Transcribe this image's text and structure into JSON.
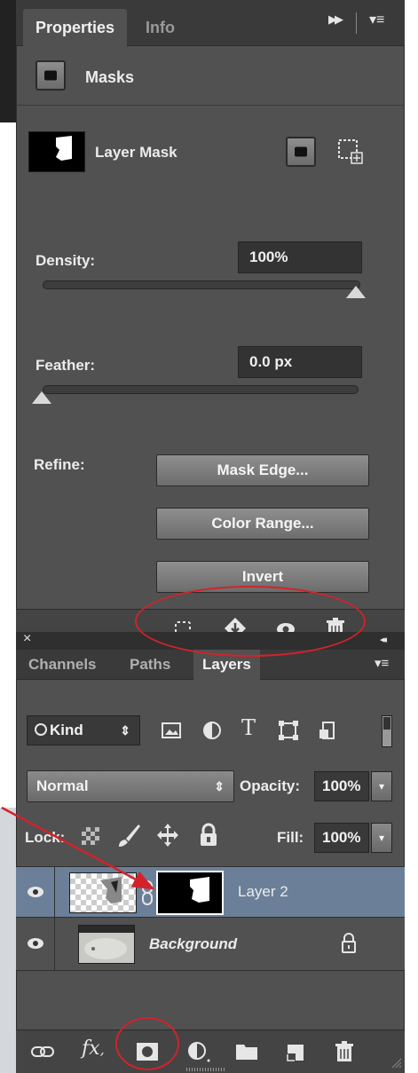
{
  "properties_panel": {
    "tabs": [
      "Properties",
      "Info"
    ],
    "header_icons": [
      "fast-forward-icon",
      "panel-menu-icon"
    ],
    "section_title": "Masks",
    "mask_label": "Layer Mask",
    "density": {
      "label": "Density:",
      "value": "100%",
      "slider_fraction": 1.0
    },
    "feather": {
      "label": "Feather:",
      "value": "0.0 px",
      "slider_fraction": 0.0
    },
    "refine_label": "Refine:",
    "buttons": [
      "Mask Edge...",
      "Color Range...",
      "Invert"
    ],
    "footer_icons": [
      "load-selection-icon",
      "apply-mask-icon",
      "visibility-icon",
      "delete-icon"
    ]
  },
  "layers_panel": {
    "tabs": [
      "Channels",
      "Paths",
      "Layers"
    ],
    "active_tab": "Layers",
    "filter": {
      "label": "Kind",
      "icons": [
        "image-filter-icon",
        "adjustment-filter-icon",
        "type-filter-icon",
        "shape-filter-icon",
        "smart-object-filter-icon"
      ]
    },
    "blend_mode": "Normal",
    "opacity": {
      "label": "Opacity:",
      "value": "100%"
    },
    "lock": {
      "label": "Lock:",
      "icons": [
        "lock-transparent-icon",
        "lock-brush-icon",
        "lock-position-icon",
        "lock-all-icon"
      ]
    },
    "fill": {
      "label": "Fill:",
      "value": "100%"
    },
    "layers": [
      {
        "name": "Layer 2",
        "selected": true,
        "has_mask": true
      },
      {
        "name": "Background",
        "selected": false,
        "locked": true
      }
    ],
    "footer_icons": [
      "link-icon",
      "fx-icon",
      "add-mask-icon",
      "adjustment-icon",
      "folder-icon",
      "new-layer-icon",
      "delete-icon"
    ]
  },
  "symbols": {
    "fast_forward": "▶▶",
    "menu": "▾≡",
    "close": "×",
    "collapse": "◂◂",
    "updown": "⇕",
    "fx": "fx",
    "comma": ",",
    "chevron": "▾"
  },
  "colors": {
    "annotation_red": "#d2232a",
    "selected_row": "#6b8098",
    "panel_bg": "#515151"
  }
}
